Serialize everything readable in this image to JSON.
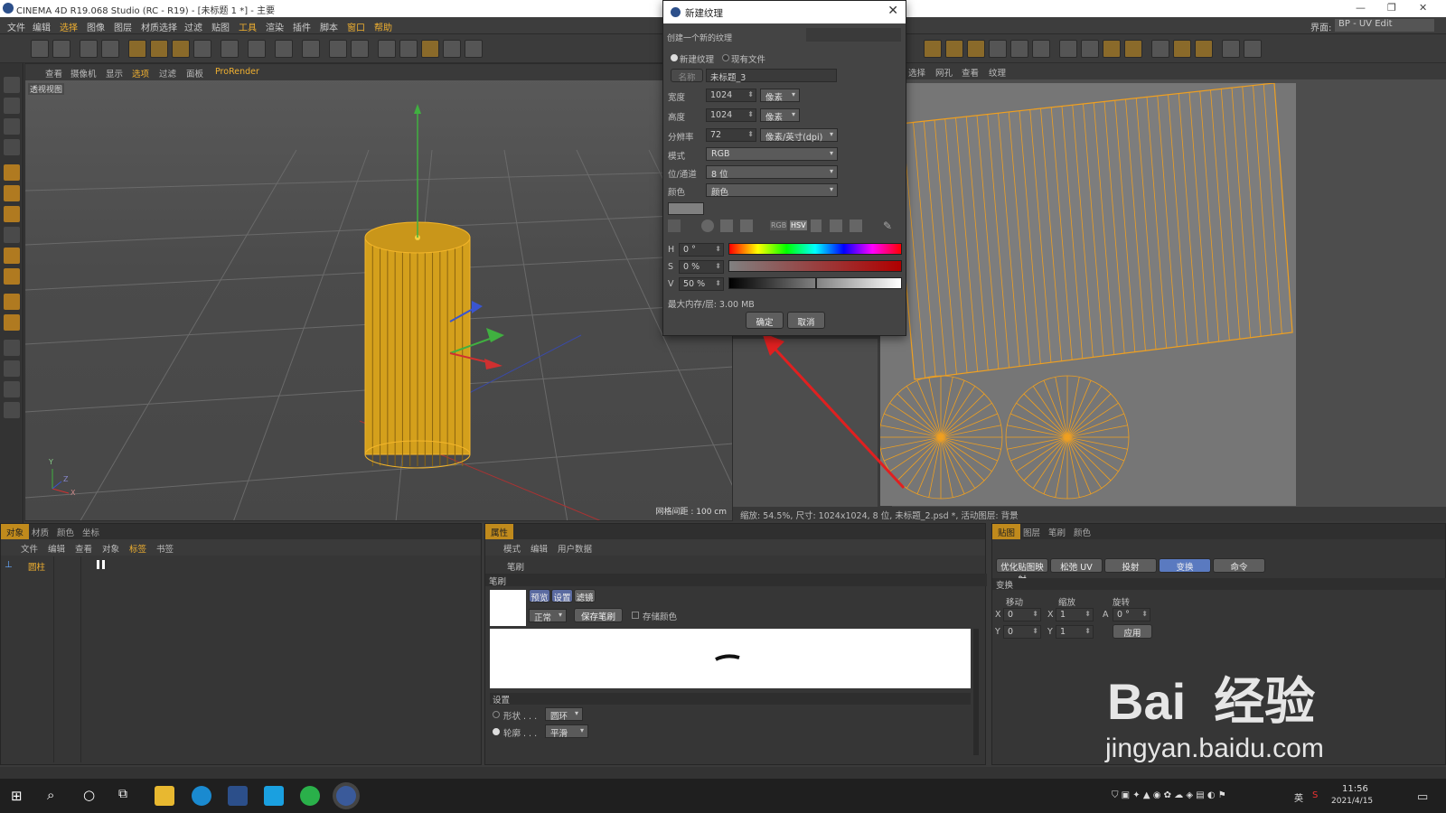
{
  "window": {
    "title": "CINEMA 4D R19.068 Studio (RC - R19) - [未标题 1 *] - 主要",
    "layout_label": "界面:",
    "layout_value": "BP - UV Edit"
  },
  "menu": [
    "文件",
    "编辑",
    "选择",
    "图像",
    "图层",
    "材质选择",
    "过滤",
    "贴图",
    "工具",
    "渲染",
    "插件",
    "脚本",
    "窗口",
    "帮助"
  ],
  "viewport": {
    "menu": [
      "查看",
      "摄像机",
      "显示",
      "选项",
      "过滤",
      "面板",
      "ProRender"
    ],
    "label": "透视视图",
    "grid_info": "网格间距 : 100 cm",
    "axes": {
      "y": "Y",
      "x": "X",
      "z": "Z"
    }
  },
  "uv": {
    "menu": [
      "选择",
      "网孔",
      "查看",
      "纹理"
    ],
    "status": "缩放: 54.5%, 尺寸: 1024x1024, 8 位, 未标题_2.psd *, 活动图层: 背景"
  },
  "dialog": {
    "title": "新建纹理",
    "subtitle": "创建一个新的纹理",
    "radio_new": "新建纹理",
    "radio_existing": "现有文件",
    "name_label": "名称",
    "name_value": "未标题_3",
    "width_label": "宽度",
    "width_value": "1024",
    "width_unit": "像素",
    "height_label": "高度",
    "height_value": "1024",
    "height_unit": "像素",
    "res_label": "分辨率",
    "res_value": "72",
    "res_unit": "像素/英寸(dpi)",
    "mode_label": "模式",
    "mode_value": "RGB",
    "depth_label": "位/通道",
    "depth_value": "8 位",
    "color_label": "颜色",
    "color_value": "颜色",
    "tabs": [
      "RGB",
      "HSV"
    ],
    "h_label": "H",
    "h_value": "0 °",
    "s_label": "S",
    "s_value": "0 %",
    "v_label": "V",
    "v_value": "50 %",
    "v_level": 0.5,
    "memory": "最大内存/层:  3.00 MB",
    "ok": "确定",
    "cancel": "取消"
  },
  "objects_panel": {
    "tabs": [
      "对象",
      "材质",
      "颜色",
      "坐标"
    ],
    "menu": [
      "文件",
      "编辑",
      "查看",
      "对象",
      "标签",
      "书签"
    ],
    "item": "圆柱"
  },
  "attr_panel": {
    "tab": "属性",
    "menu": [
      "模式",
      "编辑",
      "用户数据"
    ],
    "title": "笔刷",
    "section": "笔刷",
    "subtabs": [
      "预览",
      "设置",
      "滤镜"
    ],
    "mode": "正常",
    "save_brush": "保存笔刷",
    "store_color": "存储颜色",
    "settings": "设置",
    "shape_label": "形状 . . .",
    "shape_value": "圆环",
    "contour_label": "轮廓 . . .",
    "contour_value": "平滑"
  },
  "uv_panel": {
    "tabs": [
      "贴图",
      "图层",
      "笔刷",
      "颜色"
    ],
    "buttons": [
      "优化贴图映射",
      "松弛 UV",
      "投射",
      "变换",
      "命令"
    ],
    "section": "变换",
    "move": "移动",
    "scale": "缩放",
    "rotate": "旋转",
    "x_label": "X",
    "y_label": "Y",
    "a_label": "A",
    "move_x": "0",
    "move_y": "0",
    "scale_x": "1",
    "scale_y": "1",
    "rot": "0 °",
    "apply": "应用"
  },
  "taskbar": {
    "time": "11:56",
    "date": "2021/4/15",
    "ime": "英"
  },
  "watermark": {
    "brand": "Bai  经验",
    "url": "jingyan.baidu.com"
  },
  "colors": {
    "accent": "#c08a1c",
    "wire": "#f0a020",
    "arrow": "#e02020"
  }
}
